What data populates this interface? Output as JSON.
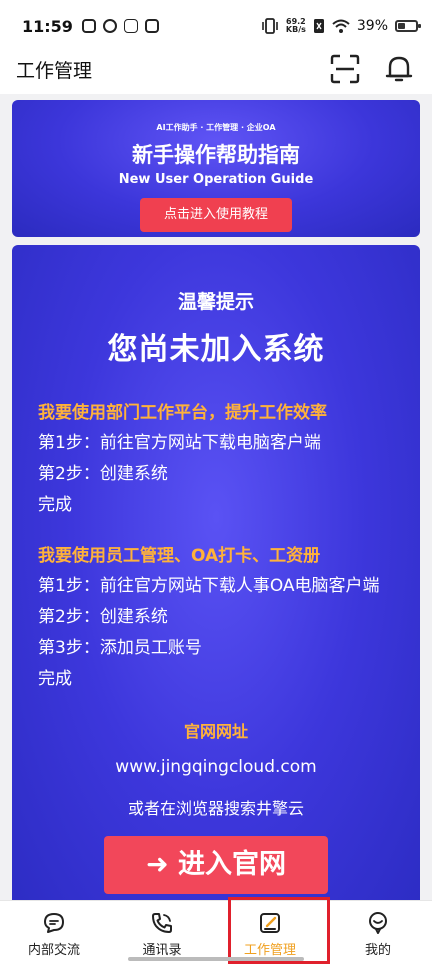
{
  "status_bar": {
    "time": "11:59",
    "net_speed_value": "69.2",
    "net_speed_unit": "KB/s",
    "battery": "39%"
  },
  "header": {
    "title": "工作管理",
    "scan_icon": "scan-icon",
    "bell_icon": "bell-icon"
  },
  "guide_banner": {
    "tags": "AI工作助手 · 工作管理 · 企业OA",
    "title": "新手操作帮助指南",
    "subtitle": "New User Operation Guide",
    "button_label": "点击进入使用教程"
  },
  "notice_card": {
    "tip_label": "温馨提示",
    "tip_title": "您尚未加入系统",
    "section1": {
      "title": "我要使用部门工作平台，提升工作效率",
      "steps": [
        "第1步：前往官方网站下载电脑客户端",
        "第2步：创建系统",
        "完成"
      ]
    },
    "section2": {
      "title": "我要使用员工管理、OA打卡、工资册",
      "steps": [
        "第1步：前往官方网站下载人事OA电脑客户端",
        "第2步：创建系统",
        "第3步：添加员工账号",
        "完成"
      ]
    },
    "official_label": "官网网址",
    "official_url": "www.jingqingcloud.com",
    "search_hint": "或者在浏览器搜索井擎云",
    "enter_button": "➜ 进入官网"
  },
  "bottom_nav": {
    "items": [
      {
        "label": "内部交流",
        "icon": "chat-icon"
      },
      {
        "label": "通讯录",
        "icon": "phone-icon"
      },
      {
        "label": "工作管理",
        "icon": "edit-icon",
        "active": true
      },
      {
        "label": "我的",
        "icon": "profile-icon"
      }
    ]
  },
  "colors": {
    "accent_orange": "#f0a020",
    "card_blue": "#3d37dc",
    "button_red": "#f2475a",
    "highlight_red": "#e0202c"
  }
}
